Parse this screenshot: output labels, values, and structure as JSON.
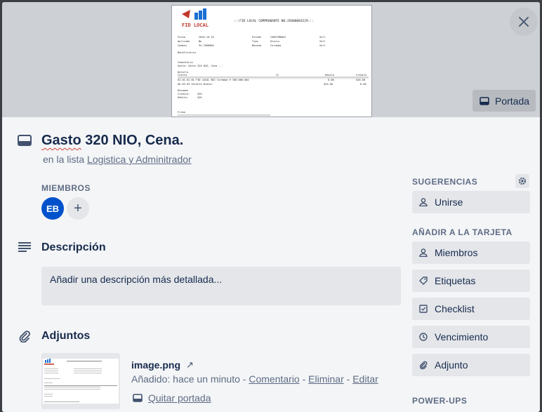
{
  "cover": {
    "button_label": "Portada",
    "image": {
      "brand": "FID LOCAL",
      "heading": ":::FID LOCAL COMPROBANTE NO:JE000003229:::",
      "fields_left": [
        [
          "Fecha",
          "2020-10-10"
        ],
        [
          "Aplicado",
          "No"
        ],
        [
          "Cambio",
          "34.7600000"
        ]
      ],
      "fields_right": [
        [
          "Estado",
          "CONFIRMADO",
          "Sell"
        ],
        [
          "Tipo",
          "Diario",
          "Sell"
        ],
        [
          "Moneda",
          "Cordoba",
          "Sell"
        ]
      ],
      "beneficiario": "Beneficiario",
      "comentario_label": "Comentario",
      "comentario": "Gasto: Gasto 320 NIO, Cena ...",
      "detalle_label": "Detalle",
      "detalle_headers": [
        "Cuenta",
        "CC",
        "Debito",
        "Credito"
      ],
      "detalle_rows": [
        [
          "01-01-01-01 FID LOCAL NIC Cordoba 9 100-000-002",
          "",
          "0.00",
          "$20.00"
        ],
        [
          "06-03-03 Gerente Wiener",
          "",
          "$20.00",
          "0.00"
        ]
      ],
      "resumen_label": "Resumen",
      "resumen_rows": [
        [
          "Credito:",
          "$20"
        ],
        [
          "Debito:",
          "$20"
        ]
      ],
      "firma_label": "Firma"
    }
  },
  "card": {
    "title_word": "Gasto",
    "title_rest": " 320 NIO, Cena.",
    "in_list_prefix": "en la lista ",
    "list_name": "Logistica y Adminitrador"
  },
  "members": {
    "label": "MIEMBROS",
    "avatar_initials": "EB",
    "add_symbol": "+"
  },
  "description": {
    "title": "Descripción",
    "placeholder": "Añadir una descripción más detallada..."
  },
  "attachments": {
    "title": "Adjuntos",
    "file_name": "image.png",
    "arrow": "↗",
    "added_text": "Añadido: hace un minuto",
    "sep": " - ",
    "comment_link": "Comentario",
    "delete_link": "Eliminar",
    "edit_link": "Editar",
    "remove_cover": "Quitar portada"
  },
  "sidebar": {
    "suggestions_label": "SUGERENCIAS",
    "join_label": "Unirse",
    "add_to_card_label": "AÑADIR A LA TARJETA",
    "add_items": [
      "Miembros",
      "Etiquetas",
      "Checklist",
      "Vencimiento",
      "Adjunto"
    ],
    "powerups_label": "POWER-UPS"
  }
}
